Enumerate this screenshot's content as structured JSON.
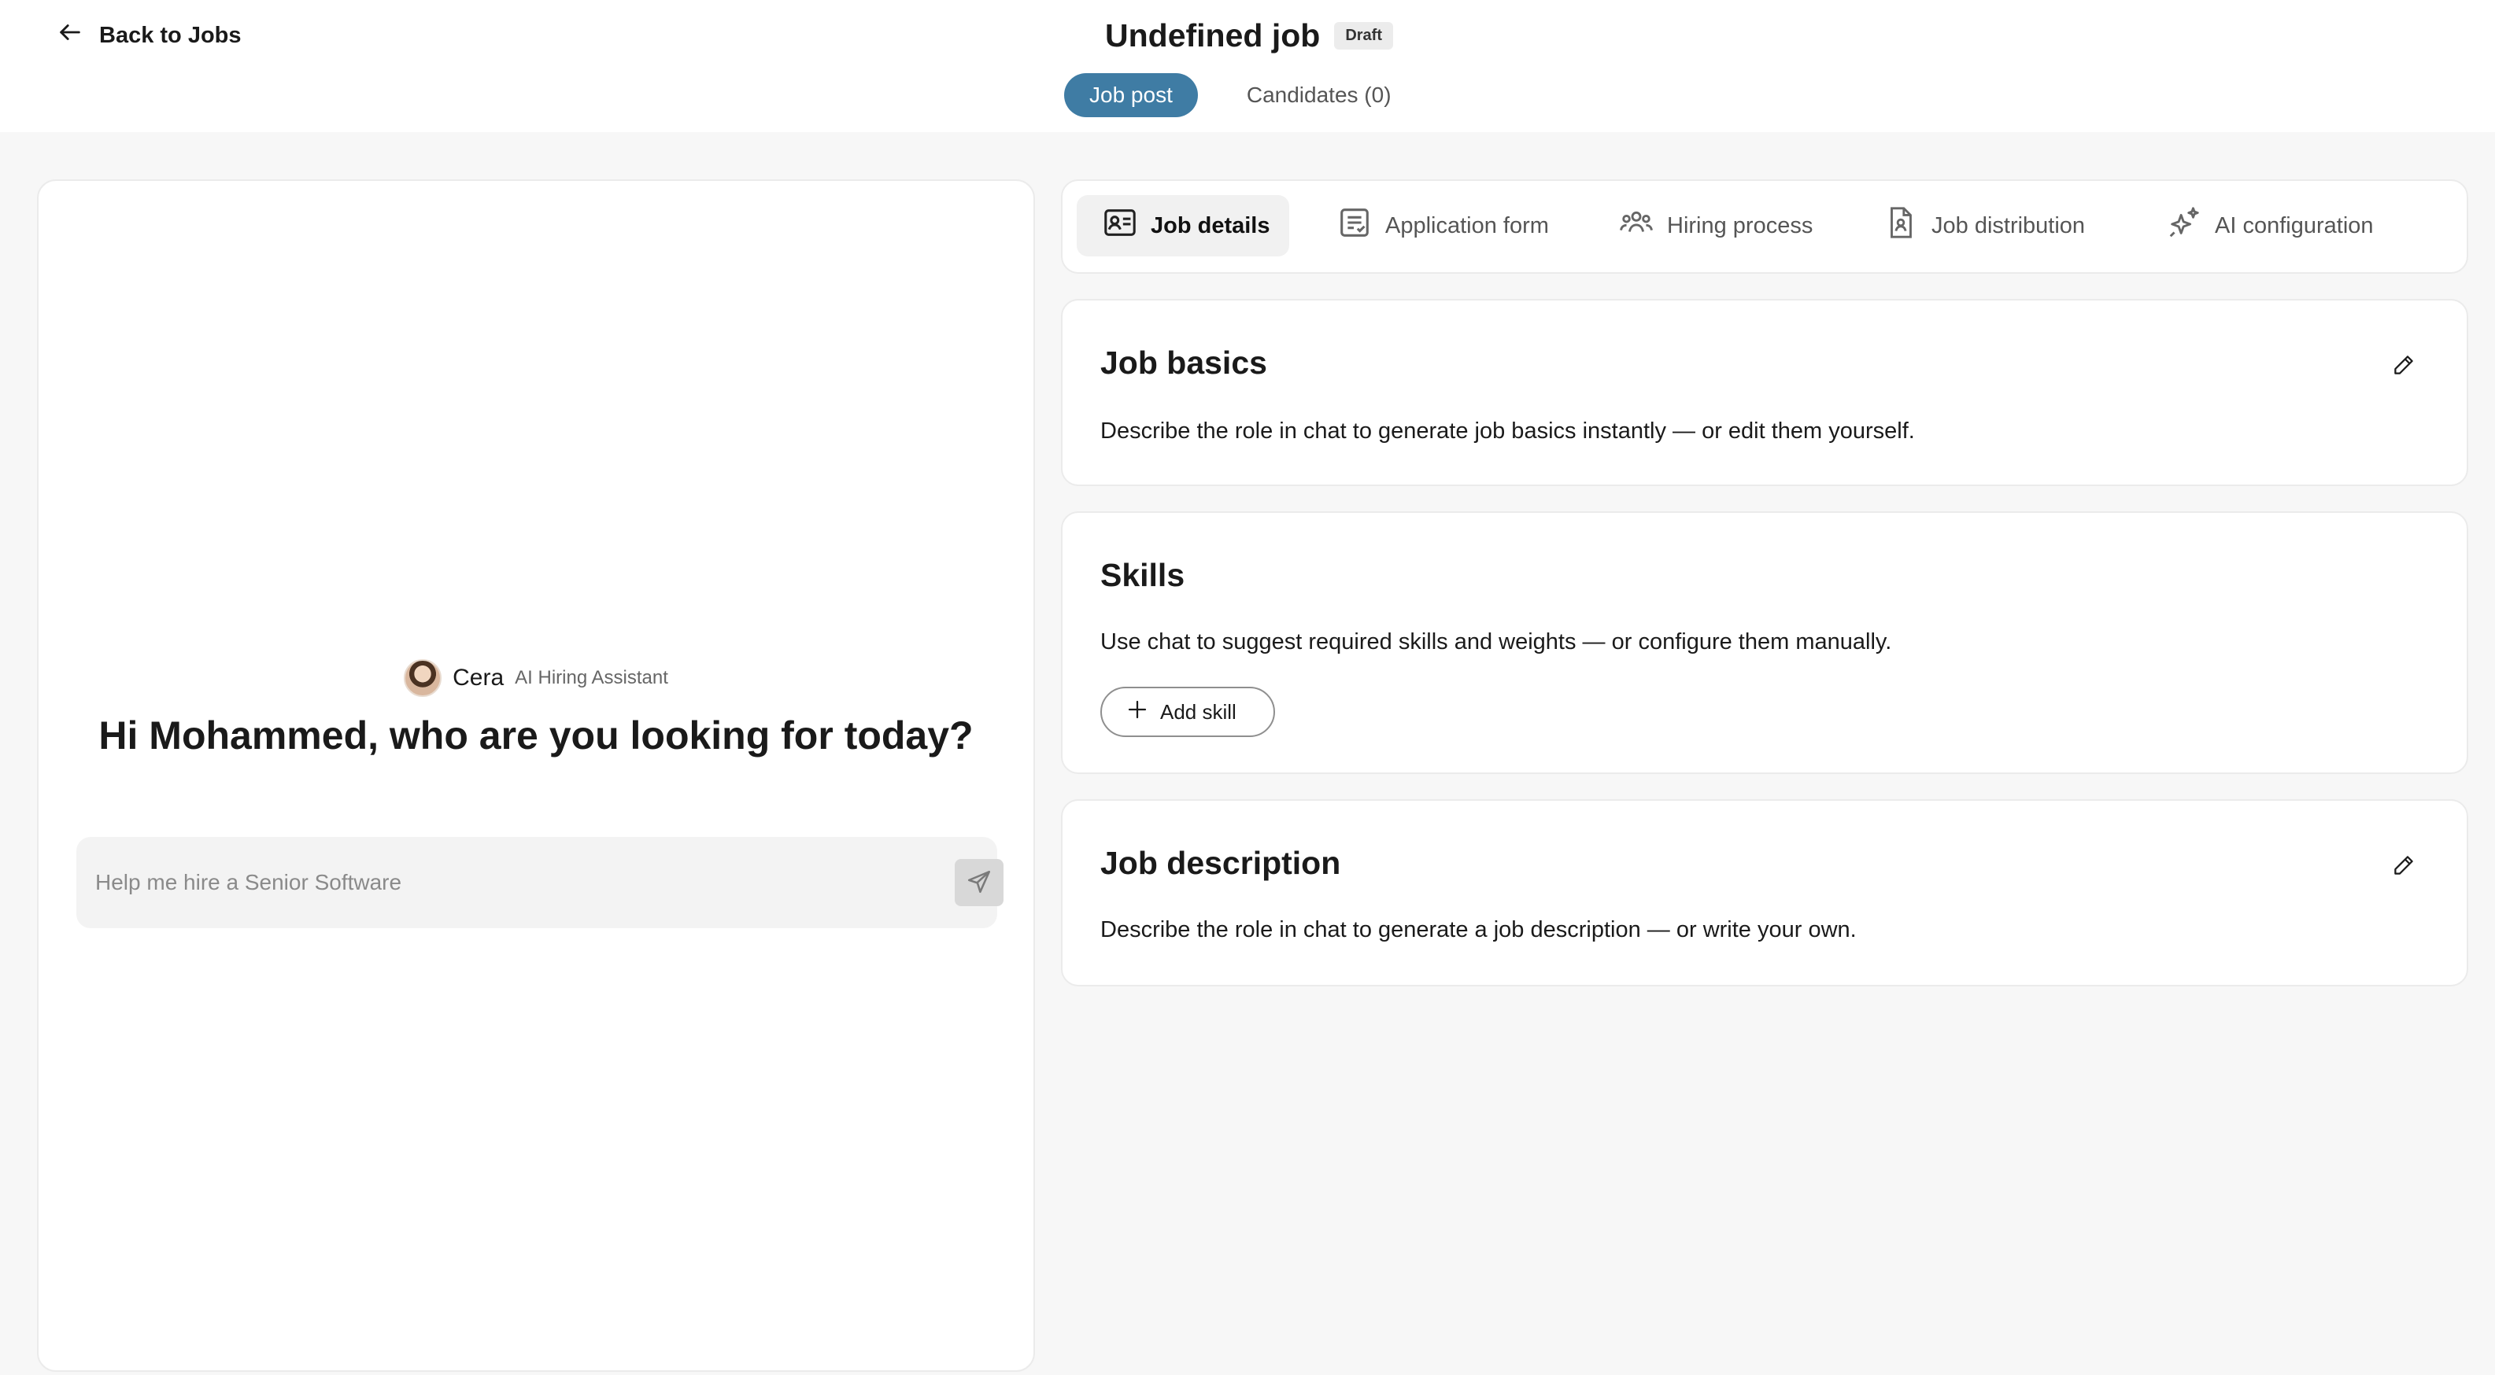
{
  "header": {
    "back_label": "Back to Jobs",
    "title": "Undefined job",
    "badge": "Draft",
    "tabs": [
      {
        "label": "Job post",
        "active": true
      },
      {
        "label": "Candidates (0)",
        "active": false
      }
    ]
  },
  "chat": {
    "assistant_name": "Cera",
    "assistant_role": "AI Hiring Assistant",
    "greeting": "Hi Mohammed, who are you looking for today?",
    "input_placeholder": "Help me hire a Senior Software",
    "input_value": ""
  },
  "section_tabs": [
    {
      "label": "Job details",
      "icon": "id-card-icon",
      "active": true
    },
    {
      "label": "Application form",
      "icon": "form-icon",
      "active": false
    },
    {
      "label": "Hiring process",
      "icon": "users-icon",
      "active": false
    },
    {
      "label": "Job distribution",
      "icon": "document-user-icon",
      "active": false
    },
    {
      "label": "AI configuration",
      "icon": "sparkle-icon",
      "active": false
    }
  ],
  "cards": {
    "job_basics": {
      "title": "Job basics",
      "description": "Describe the role in chat to generate job basics instantly — or edit them yourself."
    },
    "skills": {
      "title": "Skills",
      "description": "Use chat to suggest required skills and weights — or configure them manually.",
      "add_label": "Add skill"
    },
    "job_description": {
      "title": "Job description",
      "description": "Describe the role in chat to generate a job description — or write your own."
    }
  },
  "colors": {
    "accent": "#3f7ca4",
    "background": "#f7f7f7"
  }
}
